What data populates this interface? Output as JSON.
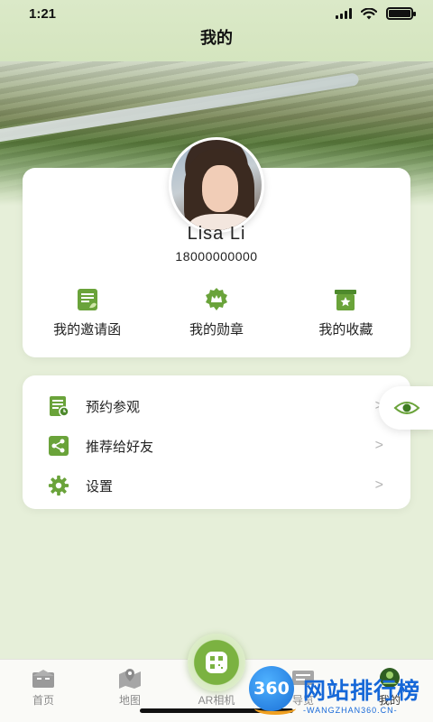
{
  "status_bar": {
    "time": "1:21"
  },
  "header": {
    "title": "我的"
  },
  "profile": {
    "name": "Lisa Li",
    "phone": "18000000000"
  },
  "quick_actions": [
    {
      "label": "我的邀请函",
      "icon": "invitation-icon"
    },
    {
      "label": "我的勋章",
      "icon": "medal-icon"
    },
    {
      "label": "我的收藏",
      "icon": "favorites-icon"
    }
  ],
  "menu": [
    {
      "label": "预约参观",
      "icon": "reservation-icon"
    },
    {
      "label": "推荐给好友",
      "icon": "share-icon"
    },
    {
      "label": "设置",
      "icon": "settings-gear-icon"
    }
  ],
  "tabs": [
    {
      "label": "首页",
      "icon": "home-icon",
      "active": false
    },
    {
      "label": "地图",
      "icon": "map-icon",
      "active": false
    },
    {
      "label": "AR相机",
      "icon": "ar-camera-icon",
      "active": false
    },
    {
      "label": "导览",
      "icon": "guide-icon",
      "active": false
    },
    {
      "label": "我的",
      "icon": "profile-icon",
      "active": true
    }
  ],
  "watermark": {
    "badge": "360",
    "title": "网站排行榜",
    "url": "-WANGZHAN360.CN-"
  },
  "colors": {
    "brand_green": "#6aa33a",
    "background": "#e6efd9",
    "card": "#ffffff"
  }
}
